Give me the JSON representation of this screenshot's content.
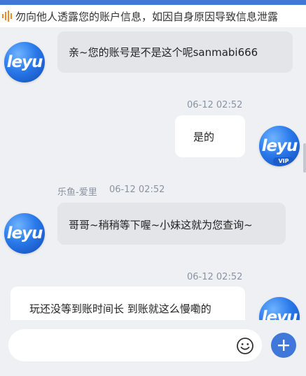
{
  "notice": {
    "text": "勿向他人透露您的账户信息，如因自身原因导致信息泄露"
  },
  "avatars": {
    "agent_logo": "leyu",
    "user_logo": "leyu",
    "user_badge": "VIP"
  },
  "messages": [
    {
      "type": "agent",
      "text": "亲~您的账号是不是这个呢sanmabi666"
    },
    {
      "type": "user",
      "time": "06-12 02:52",
      "text": "是的"
    },
    {
      "type": "agent",
      "sender": "乐鱼-爱里",
      "time": "06-12 02:52",
      "text": "哥哥~稍稍等下喔~小妹这就为您查询~"
    },
    {
      "type": "user",
      "time": "06-12 02:52",
      "text": "玩还没等到账时间长 到账就这么慢嘞的"
    }
  ],
  "composer": {
    "placeholder": ""
  },
  "colors": {
    "accent": "#3f78d8",
    "background": "#eef0f3"
  },
  "icons": [
    "speaker-icon",
    "emoji-icon",
    "plus-icon"
  ]
}
